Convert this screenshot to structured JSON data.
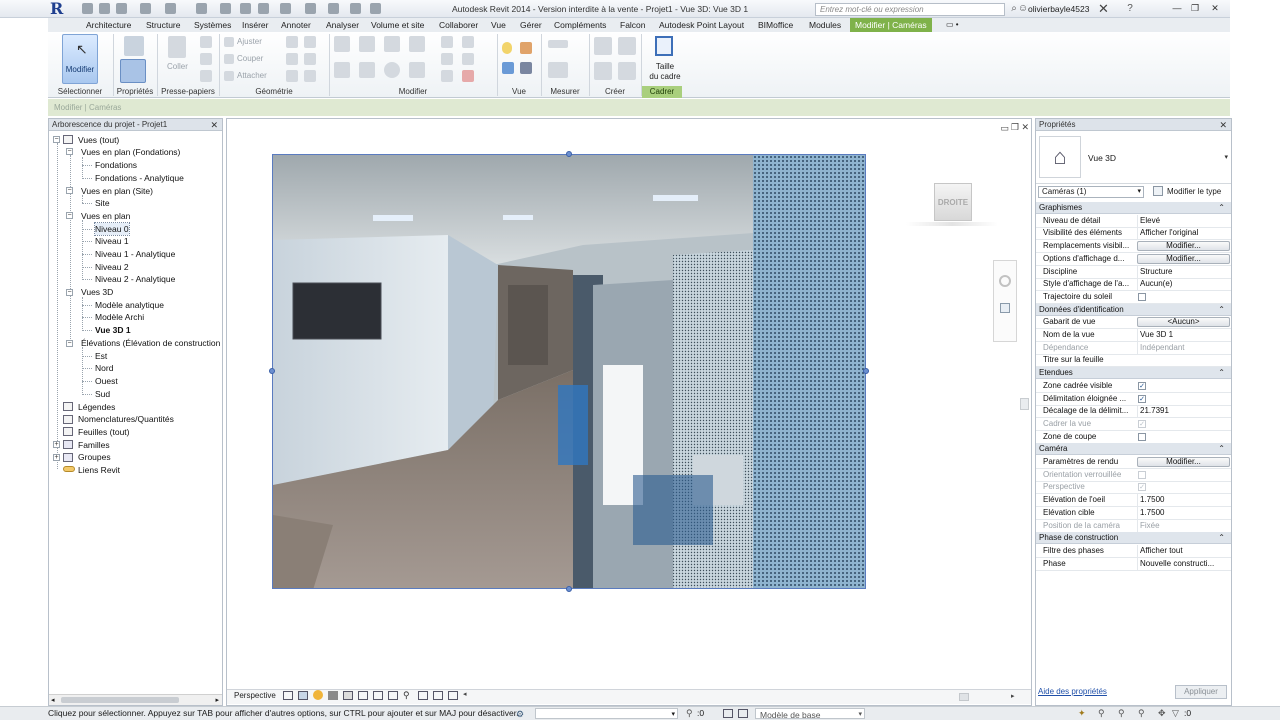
{
  "titlebar": {
    "title": "Autodesk Revit 2014 - Version interdite à la vente -    Projet1 - Vue 3D: Vue 3D 1",
    "search_placeholder": "Entrez mot-clé ou expression",
    "user": "olivierbayle4523",
    "logo_letter": "R"
  },
  "tabs": [
    "Architecture",
    "Structure",
    "Systèmes",
    "Insérer",
    "Annoter",
    "Analyser",
    "Volume et site",
    "Collaborer",
    "Vue",
    "Gérer",
    "Compléments",
    "Falcon",
    "Autodesk Point Layout",
    "BIMoffice",
    "Modules",
    "Modifier | Caméras"
  ],
  "ribbon": {
    "select_button": "Modifier",
    "panels": {
      "select": "Sélectionner",
      "properties": "Propriétés",
      "clipboard": "Presse-papiers",
      "geometry": "Géométrie",
      "modify": "Modifier",
      "view": "Vue",
      "measure": "Mesurer",
      "create": "Créer",
      "crop": "Cadrer"
    },
    "paste_label": "Coller",
    "adjust_label": "Ajuster",
    "cut_label": "Couper",
    "attach_label": "Attacher",
    "crop_size_label_1": "Taille",
    "crop_size_label_2": "du cadre"
  },
  "context_bar": "Modifier | Caméras",
  "browser": {
    "title": "Arborescence du projet - Projet1",
    "items": [
      "Vues (tout)",
      "Vues en plan (Fondations)",
      "Fondations",
      "Fondations - Analytique",
      "Vues en plan (Site)",
      "Site",
      "Vues en plan",
      "Niveau 0",
      "Niveau 1",
      "Niveau 1 - Analytique",
      "Niveau 2",
      "Niveau 2 - Analytique",
      "Vues 3D",
      "Modèle analytique",
      "Modèle Archi",
      "Vue 3D 1",
      "Élévations (Élévation de construction",
      "Est",
      "Nord",
      "Ouest",
      "Sud",
      "Légendes",
      "Nomenclatures/Quantités",
      "Feuilles (tout)",
      "Familles",
      "Groupes",
      "Liens Revit"
    ]
  },
  "view": {
    "viewcube_label": "DROITE",
    "scale_label": "Perspective"
  },
  "properties": {
    "title": "Propriétés",
    "type_name": "Vue 3D",
    "instance_filter": "Caméras (1)",
    "edit_type": "Modifier le type",
    "groups": [
      {
        "name": "Graphismes",
        "rows": [
          {
            "k": "Niveau de détail",
            "v": "Elevé"
          },
          {
            "k": "Visibilité des éléments",
            "v": "Afficher l'original"
          },
          {
            "k": "Remplacements visibil...",
            "v": "Modifier...",
            "btn": true
          },
          {
            "k": "Options d'affichage d...",
            "v": "Modifier...",
            "btn": true
          },
          {
            "k": "Discipline",
            "v": "Structure"
          },
          {
            "k": "Style d'affichage de l'a...",
            "v": "Aucun(e)"
          },
          {
            "k": "Trajectoire du soleil",
            "v": "",
            "chk": false
          }
        ]
      },
      {
        "name": "Données d'identification",
        "rows": [
          {
            "k": "Gabarit de vue",
            "v": "<Aucun>",
            "btn": true
          },
          {
            "k": "Nom de la vue",
            "v": "Vue 3D 1"
          },
          {
            "k": "Dépendance",
            "v": "Indépendant",
            "dis": true
          },
          {
            "k": "Titre sur la feuille",
            "v": ""
          }
        ]
      },
      {
        "name": "Etendues",
        "rows": [
          {
            "k": "Zone cadrée visible",
            "v": "",
            "chk": true
          },
          {
            "k": "Délimitation éloignée ...",
            "v": "",
            "chk": true
          },
          {
            "k": "Décalage de la délimit...",
            "v": "21.7391"
          },
          {
            "k": "Cadrer la vue",
            "v": "",
            "chk": true,
            "dis": true
          },
          {
            "k": "Zone de coupe",
            "v": "",
            "chk": false
          }
        ]
      },
      {
        "name": "Caméra",
        "rows": [
          {
            "k": "Paramètres de rendu",
            "v": "Modifier...",
            "btn": true
          },
          {
            "k": "Orientation verrouillée",
            "v": "",
            "chk": false,
            "dis": true
          },
          {
            "k": "Perspective",
            "v": "",
            "chk": true,
            "dis": true
          },
          {
            "k": "Elévation de l'oeil",
            "v": "1.7500"
          },
          {
            "k": "Elévation cible",
            "v": "1.7500"
          },
          {
            "k": "Position de la caméra",
            "v": "Fixée",
            "dis": true
          }
        ]
      },
      {
        "name": "Phase de construction",
        "rows": [
          {
            "k": "Filtre des phases",
            "v": "Afficher tout"
          },
          {
            "k": "Phase",
            "v": "Nouvelle constructi..."
          }
        ]
      }
    ],
    "help_link": "Aide des propriétés",
    "apply_button": "Appliquer"
  },
  "statusbar": {
    "message": "Cliquez pour sélectionner. Appuyez sur TAB pour afficher d'autres options, sur CTRL pour ajouter et sur MAJ pour désactiver.",
    "filter_count": ":0",
    "model_label": "Modèle de base"
  }
}
